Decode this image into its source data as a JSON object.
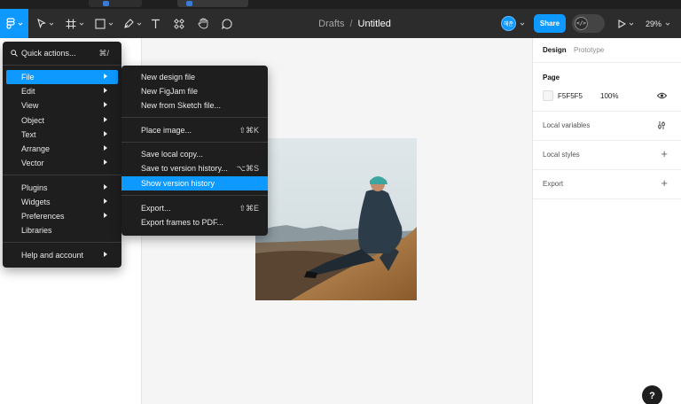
{
  "toolbar": {
    "breadcrumb": "Drafts",
    "separator": "/",
    "file_title": "Untitled",
    "avatar_initials": "해준",
    "share_label": "Share",
    "dev_mode_glyph": "</>",
    "zoom": "29%"
  },
  "main_menu": {
    "quick_actions": {
      "label": "Quick actions...",
      "shortcut": "⌘/"
    },
    "group1": [
      {
        "label": "File",
        "submenu": true,
        "active": true
      },
      {
        "label": "Edit",
        "submenu": true
      },
      {
        "label": "View",
        "submenu": true
      },
      {
        "label": "Object",
        "submenu": true
      },
      {
        "label": "Text",
        "submenu": true
      },
      {
        "label": "Arrange",
        "submenu": true
      },
      {
        "label": "Vector",
        "submenu": true
      }
    ],
    "group2": [
      {
        "label": "Plugins",
        "submenu": true
      },
      {
        "label": "Widgets",
        "submenu": true
      },
      {
        "label": "Preferences",
        "submenu": true
      },
      {
        "label": "Libraries",
        "submenu": false
      }
    ],
    "group3": [
      {
        "label": "Help and account",
        "submenu": true
      }
    ]
  },
  "file_submenu": {
    "group1": [
      {
        "label": "New design file",
        "shortcut": ""
      },
      {
        "label": "New FigJam file",
        "shortcut": ""
      },
      {
        "label": "New from Sketch file...",
        "shortcut": ""
      }
    ],
    "group2": [
      {
        "label": "Place image...",
        "shortcut": "⇧⌘K"
      }
    ],
    "group3": [
      {
        "label": "Save local copy...",
        "shortcut": ""
      },
      {
        "label": "Save to version history...",
        "shortcut": "⌥⌘S"
      },
      {
        "label": "Show version history",
        "shortcut": "",
        "active": true
      }
    ],
    "group4": [
      {
        "label": "Export...",
        "shortcut": "⇧⌘E"
      },
      {
        "label": "Export frames to PDF...",
        "shortcut": ""
      }
    ]
  },
  "right_panel": {
    "tab_design": "Design",
    "tab_prototype": "Prototype",
    "page_heading": "Page",
    "page_color": "F5F5F5",
    "page_opacity": "100%",
    "local_variables": "Local variables",
    "local_styles": "Local styles",
    "export": "Export"
  },
  "help_glyph": "?",
  "colors": {
    "accent": "#0d99ff",
    "toolbar_bg": "#2c2c2c",
    "menu_bg": "#1e1e1e",
    "canvas_bg": "#f5f5f5"
  },
  "icons": [
    "figma-menu-icon",
    "move-tool-icon",
    "frame-tool-icon",
    "shape-tool-icon",
    "pen-tool-icon",
    "text-tool-icon",
    "components-icon",
    "hand-tool-icon",
    "comment-icon",
    "play-icon",
    "search-icon",
    "eye-icon",
    "variables-icon",
    "plus-icon"
  ]
}
